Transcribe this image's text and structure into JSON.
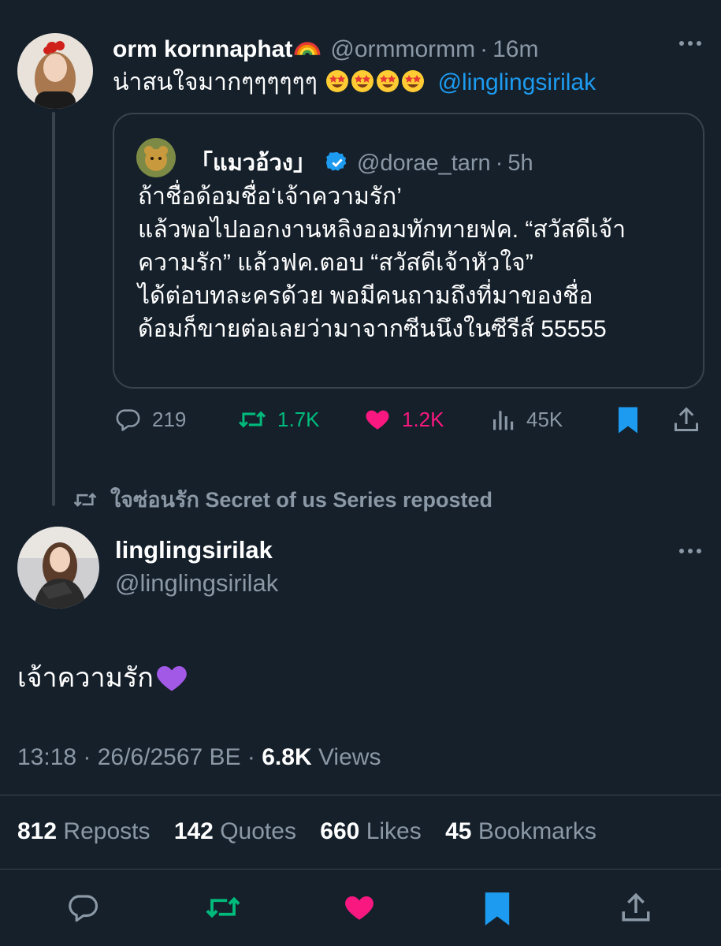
{
  "quoting_tweet": {
    "display_name": "orm kornnaphat",
    "name_emoji": "rainbow",
    "handle": "@ormmormm",
    "time": "16m",
    "text": "น่าสนใจมากๆๆๆๆๆๆ",
    "emojis": [
      "star-struck",
      "star-struck",
      "star-struck",
      "star-struck"
    ],
    "mention": "@linglingsirilak",
    "quoted": {
      "display_name": "「แมวอ้วง」",
      "verified": true,
      "handle": "@dorae_tarn",
      "time": "5h",
      "lines": [
        "ถ้าชื่อด้อมชื่อ‘เจ้าความรัก’",
        "แล้วพอไปออกงานหลิงออมทักทายฟค. “สวัสดีเจ้า",
        "ความรัก” แล้วฟค.ตอบ “สวัสดีเจ้าหัวใจ”",
        "ได้ต่อบทละครด้วย พอมีคนถามถึงที่มาของชื่อ",
        "ด้อมก็ขายต่อเลยว่ามาจากซีนนึงในซีรีส์ 55555"
      ]
    },
    "actions": {
      "replies": "219",
      "reposts": "1.7K",
      "likes": "1.2K",
      "views": "45K"
    }
  },
  "repost_note": "ใจซ่อนรัก Secret of us Series reposted",
  "main_tweet": {
    "display_name": "linglingsirilak",
    "handle": "@linglingsirilak",
    "text": "เจ้าความรัก",
    "text_emoji": "purple-heart",
    "time": "13:18",
    "date": "26/6/2567 BE",
    "views_count": "6.8K",
    "views_label": "Views",
    "stats": [
      {
        "count": "812",
        "label": "Reposts"
      },
      {
        "count": "142",
        "label": "Quotes"
      },
      {
        "count": "660",
        "label": "Likes"
      },
      {
        "count": "45",
        "label": "Bookmarks"
      }
    ]
  },
  "colors": {
    "background": "#15202b",
    "accent": "#1d9bf0",
    "repost": "#00ba7c",
    "like": "#f91880",
    "muted": "#8b98a5",
    "border": "#38444d"
  }
}
